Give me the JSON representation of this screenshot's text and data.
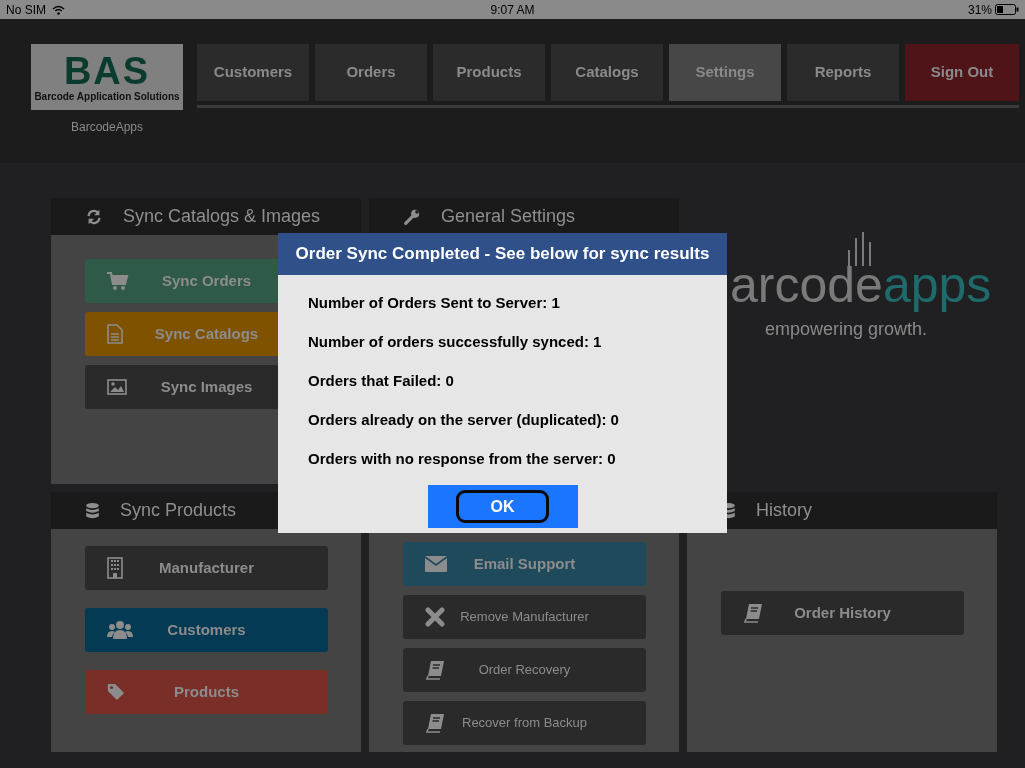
{
  "status_bar": {
    "carrier": "No SIM",
    "time": "9:07 AM",
    "battery": "31%"
  },
  "header": {
    "logo_mark": "BAS",
    "logo_subtitle": "Barcode Application Solutions",
    "caption": "BarcodeApps",
    "nav": [
      {
        "label": "Customers",
        "selected": false,
        "kind": "normal"
      },
      {
        "label": "Orders",
        "selected": false,
        "kind": "normal"
      },
      {
        "label": "Products",
        "selected": false,
        "kind": "normal"
      },
      {
        "label": "Catalogs",
        "selected": false,
        "kind": "normal"
      },
      {
        "label": "Settings",
        "selected": true,
        "kind": "normal"
      },
      {
        "label": "Reports",
        "selected": false,
        "kind": "normal"
      },
      {
        "label": "Sign Out",
        "selected": false,
        "kind": "danger"
      }
    ]
  },
  "panels": [
    {
      "title": "Sync Catalogs & Images",
      "buttons": [
        {
          "label": "Sync Orders",
          "color": "#2f5a47",
          "kind": "bold"
        },
        {
          "label": "Sync Catalogs",
          "color": "#7f5200",
          "kind": "bold"
        },
        {
          "label": "Sync Images",
          "color": "#2a2a2a",
          "kind": "bold"
        }
      ]
    },
    {
      "title": "General Settings"
    },
    {
      "title": "Sync Products",
      "buttons": [
        {
          "label": "Manufacturer",
          "color": "#2a2a2a",
          "kind": "bold"
        },
        {
          "label": "Customers",
          "color": "#053a55",
          "kind": "bold"
        },
        {
          "label": "Products",
          "color": "#7a2e28",
          "kind": "bold"
        }
      ]
    },
    {
      "buttons": [
        {
          "label": "Email Support",
          "color": "#1f4a5c",
          "kind": "bold"
        },
        {
          "label": "Remove Manufacturer",
          "color": "#2a2a2a",
          "kind": "plain"
        },
        {
          "label": "Order Recovery",
          "color": "#2a2a2a",
          "kind": "plain"
        },
        {
          "label": "Recover from Backup",
          "color": "#2a2a2a",
          "kind": "plain"
        }
      ]
    },
    {
      "title": "History",
      "buttons": [
        {
          "label": "Order History",
          "color": "#2a2a2a",
          "kind": "bold"
        }
      ]
    }
  ],
  "brand": {
    "word_start": "arcode",
    "word_end": "apps",
    "tagline": "empowering growth."
  },
  "dialog": {
    "title": "Order Sync Completed - See below for sync results",
    "lines": [
      "Number of Orders Sent to Server: 1",
      "Number of orders successfully synced: 1",
      "Orders that Failed: 0",
      "Orders already on the server (duplicated): 0",
      "Orders with no response from the server: 0"
    ],
    "button": "OK"
  }
}
